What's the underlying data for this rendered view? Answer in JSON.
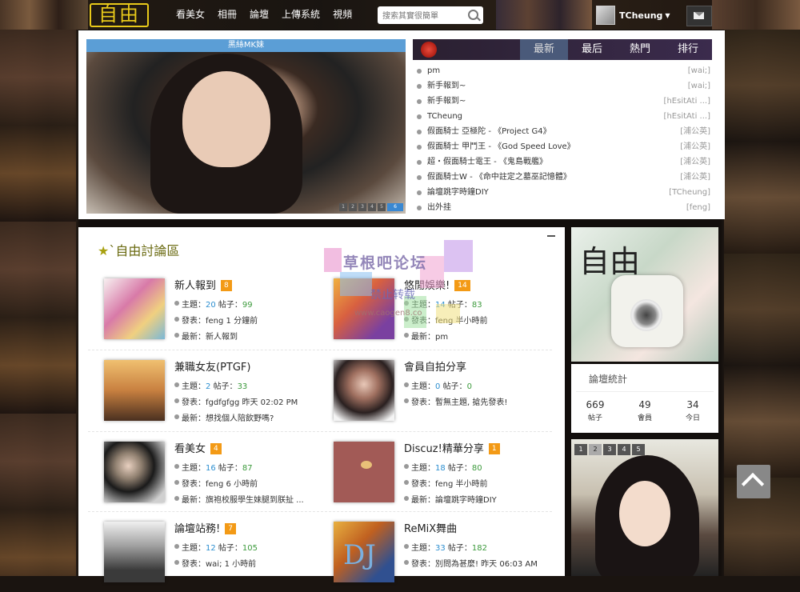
{
  "header": {
    "logo": "自由",
    "nav": [
      "看美女",
      "相冊",
      "論壇",
      "上傳系統",
      "視頻"
    ],
    "search_placeholder": "搜索其實很簡單",
    "username": "TCheung"
  },
  "slideshow": {
    "caption": "黑絲MK妹",
    "pages": [
      "1",
      "2",
      "3",
      "4",
      "5",
      "6"
    ],
    "active_page": "6"
  },
  "latest": {
    "tabs": [
      "最新",
      "最后",
      "熱門",
      "排行"
    ],
    "active_tab": "最新",
    "items": [
      {
        "title": "pm",
        "author": "[wai;]"
      },
      {
        "title": "新手報到~",
        "author": "[wai;]"
      },
      {
        "title": "新手報到~",
        "author": "[hEsitAti ...]"
      },
      {
        "title": "TCheung",
        "author": "[hEsitAti ...]"
      },
      {
        "title": "假面騎士 亞極陀 - 《Project G4》",
        "author": "[浦公英]"
      },
      {
        "title": "假面騎士 甲鬥王 - 《God Speed Love》",
        "author": "[浦公英]"
      },
      {
        "title": "超・假面騎士電王 - 《鬼島戰艦》",
        "author": "[浦公英]"
      },
      {
        "title": "假面騎士W - 《命中註定之墓巫記憶體》",
        "author": "[浦公英]"
      },
      {
        "title": "論壇跳字時鐘DIY",
        "author": "[TCheung]"
      },
      {
        "title": "出外挂",
        "author": "[feng]"
      }
    ]
  },
  "forum_section": {
    "title": "`自由討論區",
    "label_topics": "主題：",
    "label_posts": "帖子：",
    "label_posted": "發表：",
    "label_latest": "最新：",
    "boards": [
      {
        "name": "新人報到",
        "count": "8",
        "topics": "20",
        "posts": "99",
        "posted": "feng 1 分鐘前",
        "latest": "新人報到"
      },
      {
        "name": "悠閒娛樂!",
        "count": "14",
        "topics": "14",
        "posts": "83",
        "posted": "feng 半小時前",
        "latest": "pm"
      },
      {
        "name": "兼職女友(PTGF)",
        "count": "",
        "topics": "2",
        "posts": "33",
        "posted": "fgdfgfgg 昨天 02:02 PM",
        "latest": "想找個人陪飲野嗎?"
      },
      {
        "name": "會員自拍分享",
        "count": "",
        "topics": "0",
        "posts": "0",
        "posted": "暫無主題, 搶先發表!",
        "latest": ""
      },
      {
        "name": "看美女",
        "count": "4",
        "topics": "16",
        "posts": "87",
        "posted": "feng 6 小時前",
        "latest": "旗袍校服學生妹腿到朕扯 ..."
      },
      {
        "name": "Discuz!精華分享",
        "count": "1",
        "topics": "18",
        "posts": "80",
        "posted": "feng 半小時前",
        "latest": "論壇跳字時鐘DIY"
      },
      {
        "name": "論壇站務!",
        "count": "7",
        "topics": "12",
        "posts": "105",
        "posted": "wai; 1 小時前",
        "latest": ""
      },
      {
        "name": "ReMiX舞曲",
        "count": "",
        "topics": "33",
        "posts": "182",
        "posted": "別問為甚麼! 昨天 06:03 AM",
        "latest": ""
      }
    ]
  },
  "sidebar": {
    "logo_text": "自由",
    "stats_title": "論壇統計",
    "stats": [
      {
        "value": "669",
        "label": "帖子"
      },
      {
        "value": "49",
        "label": "會員"
      },
      {
        "value": "34",
        "label": "今日"
      }
    ],
    "gallery_pages": [
      "1",
      "2",
      "3",
      "4",
      "5"
    ],
    "gallery_active": "2"
  },
  "watermark": {
    "line1": "草根吧论坛",
    "line2": "禁止转载",
    "line3": "www.caogen8.co"
  },
  "colors": {
    "accent_blue": "#5b9ed6",
    "count_badge": "#f39a16",
    "number_blue": "#2d8fd0",
    "number_green": "#3c9a3c",
    "logo_yellow": "#e8c91a"
  }
}
